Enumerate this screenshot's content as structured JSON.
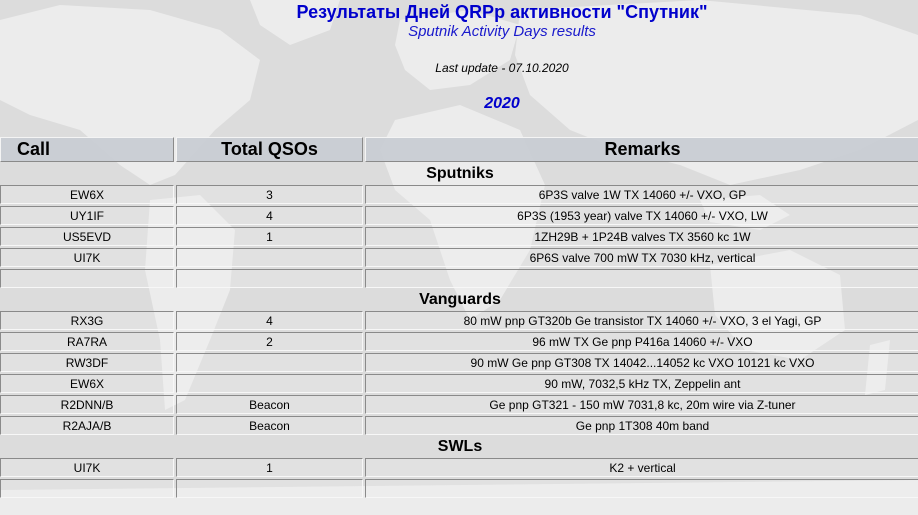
{
  "header": {
    "title_ru": "Результаты Дней QRPp активности \"Спутник\"",
    "title_en": "Sputnik Activity Days results",
    "last_update": "Last update - 07.10.2020",
    "year": "2020"
  },
  "table": {
    "columns": [
      "Call",
      "Total QSOs",
      "Remarks"
    ],
    "sections": [
      {
        "name": "Sputniks",
        "rows": [
          {
            "call": "EW6X",
            "qsos": "3",
            "remarks": "6P3S valve 1W TX 14060 +/- VXO, GP"
          },
          {
            "call": "UY1IF",
            "qsos": "4",
            "remarks": "6P3S (1953 year) valve TX 14060 +/- VXO, LW"
          },
          {
            "call": "US5EVD",
            "qsos": "1",
            "remarks": "1ZH29B + 1P24B valves TX 3560 kc 1W"
          },
          {
            "call": "UI7K",
            "qsos": "",
            "remarks": "6P6S valve 700 mW TX 7030 kHz, vertical"
          },
          {
            "call": "",
            "qsos": "",
            "remarks": ""
          }
        ]
      },
      {
        "name": "Vanguards",
        "rows": [
          {
            "call": "RX3G",
            "qsos": "4",
            "remarks": "80 mW pnp GT320b Ge transistor TX 14060 +/- VXO, 3 el Yagi, GP"
          },
          {
            "call": "RA7RA",
            "qsos": "2",
            "remarks": "96 mW TX Ge pnp P416a 14060 +/- VXO"
          },
          {
            "call": "RW3DF",
            "qsos": "",
            "remarks": "90 mW Ge pnp GT308 TX 14042...14052 kc VXO 10121 kc VXO"
          },
          {
            "call": "EW6X",
            "qsos": "",
            "remarks": "90 mW, 7032,5 kHz TX, Zeppelin ant"
          },
          {
            "call": "R2DNN/B",
            "qsos": "Beacon",
            "remarks": "Ge pnp GT321 - 150 mW 7031,8 kc, 20m wire via Z-tuner"
          },
          {
            "call": "R2AJA/B",
            "qsos": "Beacon",
            "remarks": "Ge pnp 1T308 40m band"
          }
        ]
      },
      {
        "name": "SWLs",
        "rows": [
          {
            "call": "UI7K",
            "qsos": "1",
            "remarks": "K2 + vertical"
          },
          {
            "call": "",
            "qsos": "",
            "remarks": ""
          }
        ]
      }
    ]
  }
}
